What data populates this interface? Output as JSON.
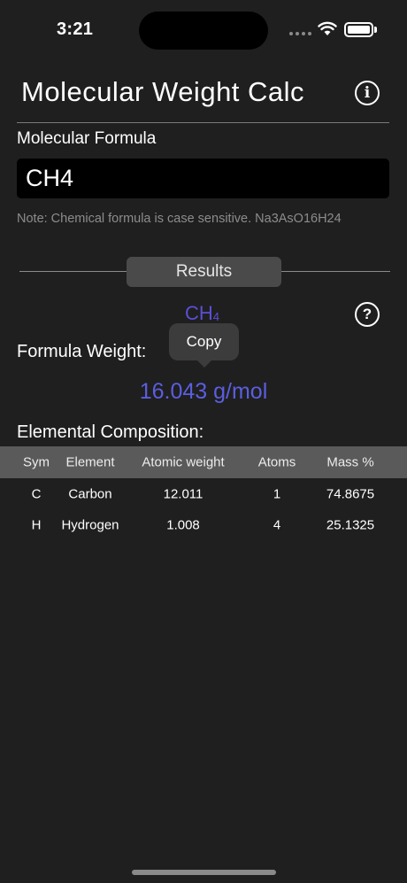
{
  "status_bar": {
    "time": "3:21"
  },
  "header": {
    "title": "Molecular Weight Calc",
    "info_glyph": "i"
  },
  "formula": {
    "label": "Molecular Formula",
    "value": "CH4",
    "note": "Note: Chemical formula is case sensitive. Na3AsO16H24"
  },
  "results": {
    "label": "Results",
    "formula_main": "CH",
    "formula_sub": "4",
    "help_glyph": "?",
    "weight_label": "Formula Weight:",
    "copy_label": "Copy",
    "weight_value": "16.043 g/mol",
    "composition_label": "Elemental Composition:"
  },
  "table": {
    "headers": {
      "sym": "Sym",
      "element": "Element",
      "atomic_weight": "Atomic weight",
      "atoms": "Atoms",
      "mass": "Mass %"
    },
    "rows": [
      {
        "sym": "C",
        "element": "Carbon",
        "atomic_weight": "12.011",
        "atoms": "1",
        "mass": "74.8675"
      },
      {
        "sym": "H",
        "element": "Hydrogen",
        "atomic_weight": "1.008",
        "atoms": "4",
        "mass": "25.1325"
      }
    ]
  },
  "colors": {
    "accent_formula": "#5b4fd6",
    "accent_weight": "#5b5ee0",
    "background": "#1f1f1f"
  },
  "icons": {
    "info": "info-circle-icon",
    "help": "question-circle-icon",
    "wifi": "wifi-icon",
    "battery": "battery-icon"
  }
}
